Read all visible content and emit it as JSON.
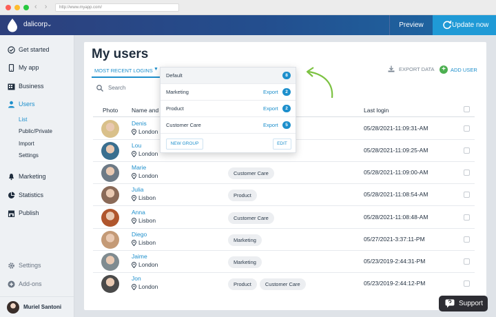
{
  "browser": {
    "url": "http://www.myapp.com/"
  },
  "topbar": {
    "company": "dalicorp",
    "preview": "Preview",
    "update": "Update now"
  },
  "sidebar": {
    "items": [
      {
        "label": "Get started"
      },
      {
        "label": "My app"
      },
      {
        "label": "Business"
      },
      {
        "label": "Users"
      },
      {
        "label": "Marketing"
      },
      {
        "label": "Statistics"
      },
      {
        "label": "Publish"
      }
    ],
    "users_sub": [
      "List",
      "Public/Private",
      "Import",
      "Settings"
    ],
    "bottom": [
      {
        "label": "Settings"
      },
      {
        "label": "Add-ons"
      }
    ],
    "user_name": "Muriel Santoni"
  },
  "main": {
    "title": "My users",
    "filter_tab": "MOST RECENT LOGINS",
    "export_data": "EXPORT DATA",
    "add_user": "ADD USER",
    "search_placeholder": "Search",
    "columns": {
      "photo": "Photo",
      "name": "Name and p",
      "last_login": "Last login"
    },
    "rows": [
      {
        "name": "Denis",
        "location": "London",
        "tags": [],
        "last_login": "05/28/2021-11:09:31-AM",
        "avatar_color": "#d9c08a"
      },
      {
        "name": "Lou",
        "location": "London",
        "tags": [],
        "last_login": "05/28/2021-11:09:25-AM",
        "avatar_color": "#3a6f8f"
      },
      {
        "name": "Marie",
        "location": "London",
        "tags": [
          "Customer Care"
        ],
        "last_login": "05/28/2021-11:09:00-AM",
        "avatar_color": "#6d7a86"
      },
      {
        "name": "Julia",
        "location": "Lisbon",
        "tags": [
          "Product"
        ],
        "last_login": "05/28/2021-11:08:54-AM",
        "avatar_color": "#8a6a58"
      },
      {
        "name": "Anna",
        "location": "Lisbon",
        "tags": [
          "Customer Care"
        ],
        "last_login": "05/28/2021-11:08:48-AM",
        "avatar_color": "#b0562d"
      },
      {
        "name": "Diego",
        "location": "Lisbon",
        "tags": [
          "Marketing"
        ],
        "last_login": "05/27/2021-3:37:11-PM",
        "avatar_color": "#c49a76"
      },
      {
        "name": "Jaime",
        "location": "London",
        "tags": [
          "Marketing"
        ],
        "last_login": "05/23/2019-2:44:31-PM",
        "avatar_color": "#7f8b90"
      },
      {
        "name": "Jon",
        "location": "London",
        "tags": [
          "Product",
          "Customer Care"
        ],
        "last_login": "05/23/2019-2:44:12-PM",
        "avatar_color": "#4a4a4a"
      }
    ]
  },
  "dropdown": {
    "items": [
      {
        "label": "Default",
        "export": "",
        "count": "8"
      },
      {
        "label": "Marketing",
        "export": "Export",
        "count": "2"
      },
      {
        "label": "Product",
        "export": "Export",
        "count": "2"
      },
      {
        "label": "Customer Care",
        "export": "Export",
        "count": "5"
      }
    ],
    "new_group": "NEW GROUP",
    "edit": "EDIT"
  },
  "support": "Support",
  "colors": {
    "accent": "#1d8fcc",
    "update_button": "#1f9ad6",
    "add_user_icon": "#4caf50",
    "annotation_arrow": "#7cc242"
  }
}
